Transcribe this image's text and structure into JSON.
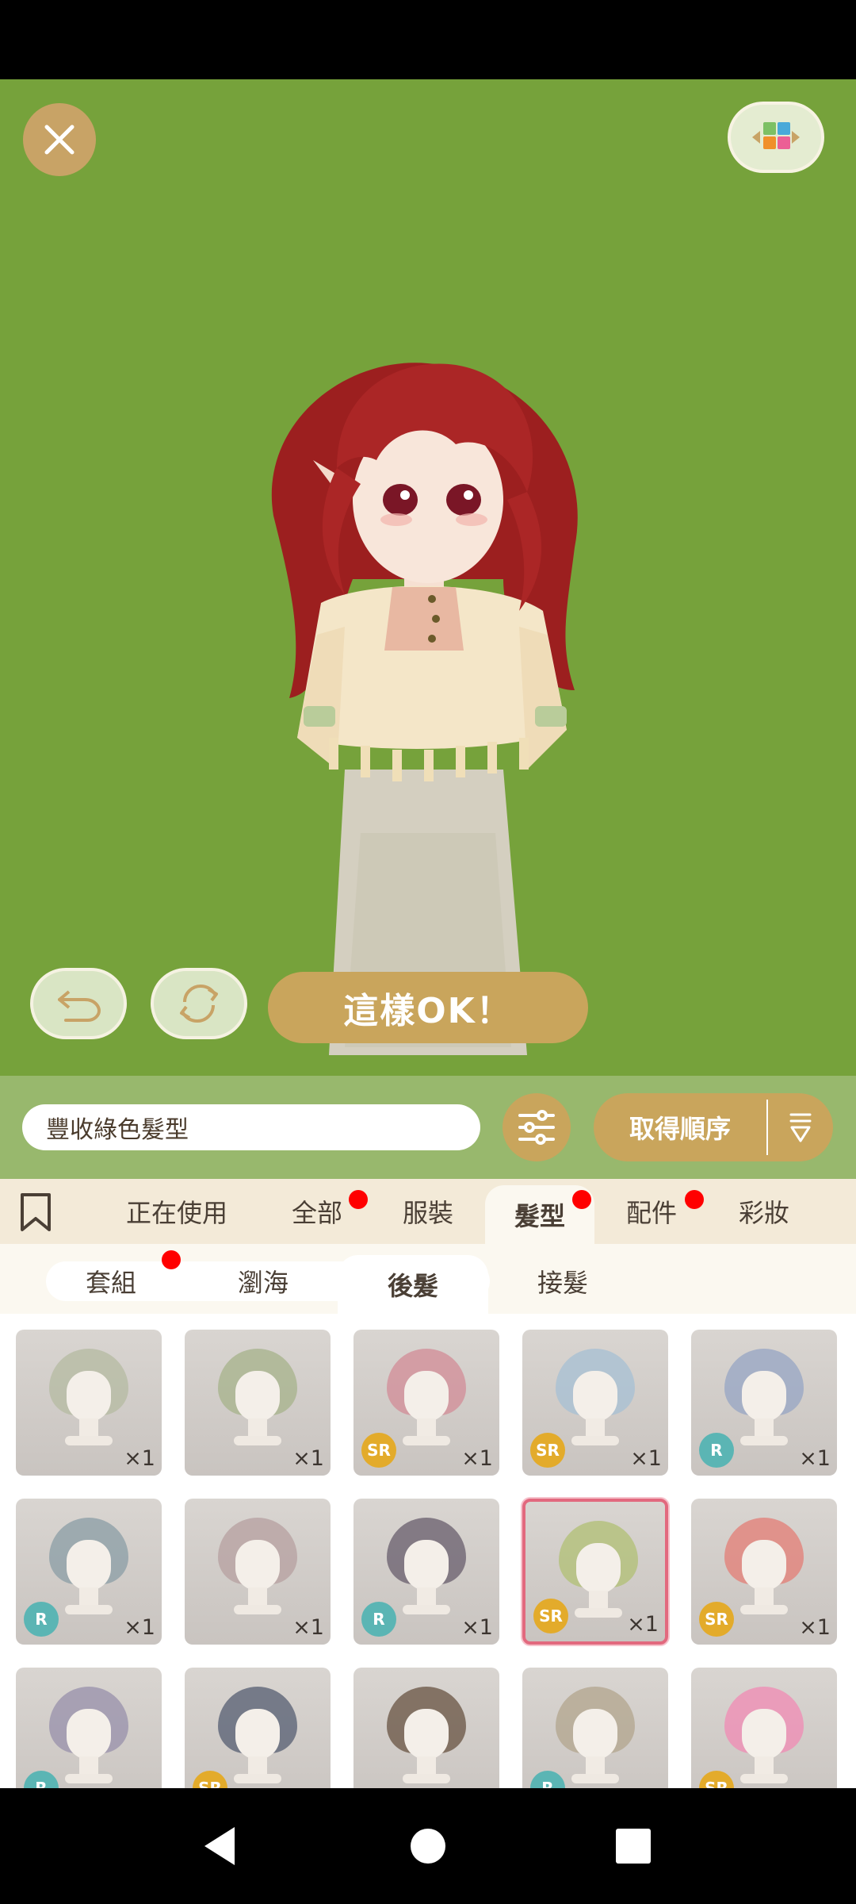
{
  "top": {
    "close_icon": "close-icon",
    "grid_icon": "color-grid-icon"
  },
  "controls": {
    "undo_icon": "undo-arrow-icon",
    "refresh_icon": "refresh-arrows-icon",
    "confirm_label": "這樣OK！"
  },
  "search": {
    "value": "豐收綠色髮型",
    "filter_icon": "sliders-icon",
    "sort_label": "取得順序",
    "sort_icon": "sort-down-icon"
  },
  "categories": {
    "bookmark_icon": "bookmark-icon",
    "tabs": [
      "正在使用",
      "全部",
      "服裝",
      "髮型",
      "配件",
      "彩妝"
    ],
    "active": "髮型",
    "badges": [
      "全部",
      "髮型",
      "配件"
    ]
  },
  "subcategories": {
    "tabs": [
      "套組",
      "瀏海",
      "後髮",
      "接髮"
    ],
    "active": "後髮",
    "badges": [
      "套組"
    ]
  },
  "items": [
    {
      "qty": "×1",
      "rarity": "",
      "hair": "#b7bba4"
    },
    {
      "qty": "×1",
      "rarity": "",
      "hair": "#a9b48e"
    },
    {
      "qty": "×1",
      "rarity": "SR",
      "hair": "#d2909a"
    },
    {
      "qty": "×1",
      "rarity": "SR",
      "hair": "#a9c1d3"
    },
    {
      "qty": "×1",
      "rarity": "R",
      "hair": "#9aa8c4"
    },
    {
      "qty": "×1",
      "rarity": "R",
      "hair": "#8ea0a8"
    },
    {
      "qty": "×1",
      "rarity": "",
      "hair": "#b8a3a2"
    },
    {
      "qty": "×1",
      "rarity": "R",
      "hair": "#6e6472"
    },
    {
      "qty": "×1",
      "rarity": "SR",
      "hair": "#b3c079",
      "selected": true
    },
    {
      "qty": "×1",
      "rarity": "SR",
      "hair": "#e2827a"
    },
    {
      "qty": "",
      "rarity": "R",
      "hair": "#9b93ad"
    },
    {
      "qty": "",
      "rarity": "SR",
      "hair": "#5c6477"
    },
    {
      "qty": "",
      "rarity": "",
      "hair": "#6e5a4a"
    },
    {
      "qty": "",
      "rarity": "R",
      "hair": "#b4a891"
    },
    {
      "qty": "",
      "rarity": "SR",
      "hair": "#ef8fb5"
    }
  ],
  "nav": {
    "back_icon": "back-triangle-icon",
    "home_icon": "home-circle-icon",
    "recents_icon": "recents-square-icon"
  }
}
